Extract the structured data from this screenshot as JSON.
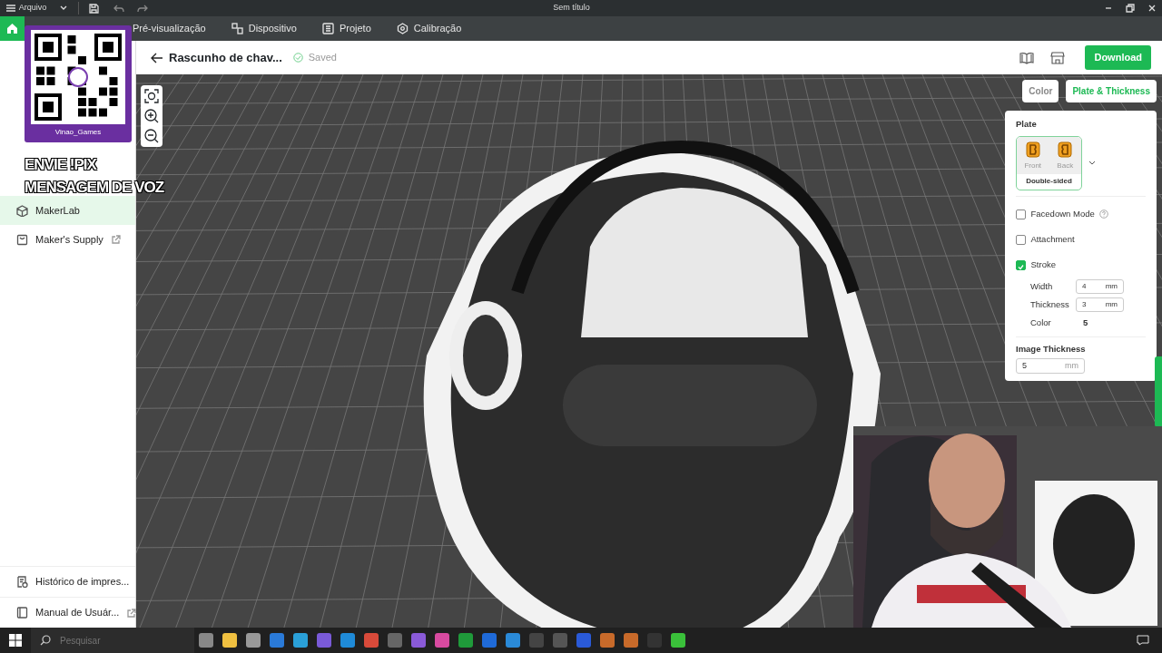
{
  "window": {
    "menu_label": "Arquivo",
    "title": "Sem título"
  },
  "tabs": [
    {
      "label": "Pré-visualização",
      "selected": false
    },
    {
      "label": "Dispositivo",
      "selected": false
    },
    {
      "label": "Projeto",
      "selected": false
    },
    {
      "label": "Calibração",
      "selected": false
    }
  ],
  "sidebar": {
    "items": [
      {
        "label": "MakerLab",
        "selected": true,
        "external": false
      },
      {
        "label": "Maker's Supply",
        "selected": false,
        "external": true
      }
    ],
    "bottom_items": [
      {
        "label": "Histórico de impres...",
        "external": false
      },
      {
        "label": "Manual de Usuár...",
        "external": true
      }
    ]
  },
  "header": {
    "title": "Rascunho de chav...",
    "status": "Saved",
    "download": "Download"
  },
  "panel_tabs": [
    {
      "label": "Color",
      "selected": false
    },
    {
      "label": "Plate & Thickness",
      "selected": true
    }
  ],
  "panel": {
    "plate_title": "Plate",
    "sides": [
      "Front",
      "Back"
    ],
    "plate_mode": "Double-sided",
    "options": [
      {
        "label": "Facedown Mode",
        "checked": false,
        "help": true
      },
      {
        "label": "Attachment",
        "checked": false,
        "help": false
      },
      {
        "label": "Stroke",
        "checked": true,
        "help": false
      }
    ],
    "stroke_fields": [
      {
        "label": "Width",
        "value": "4",
        "unit": "mm"
      },
      {
        "label": "Thickness",
        "value": "3",
        "unit": "mm"
      }
    ],
    "stroke_color_label": "Color",
    "stroke_color_value": "5",
    "image_thickness_title": "Image Thickness",
    "image_thickness_value": "5",
    "image_thickness_unit": "mm"
  },
  "overlay": {
    "qr_caption": "Vinao_Games",
    "lines": [
      "ENVIE !PIX",
      "MENSAGEM DE VOZ"
    ]
  },
  "taskbar": {
    "search_placeholder": "Pesquisar"
  }
}
